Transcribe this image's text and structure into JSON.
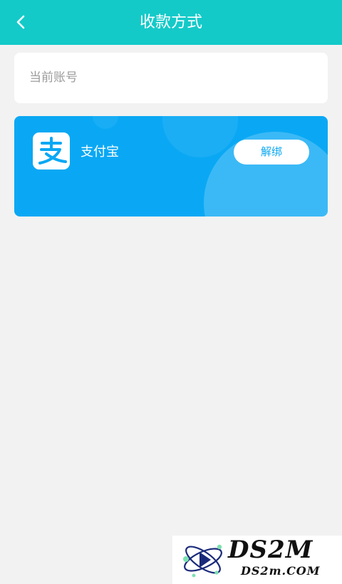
{
  "header": {
    "title": "收款方式",
    "back_icon": "chevron-left-icon",
    "background_color": "#13cac9"
  },
  "account": {
    "label": "当前账号"
  },
  "alipay": {
    "name": "支付宝",
    "logo_text": "支",
    "logo_icon": "alipay-logo-icon",
    "unbind_label": "解绑",
    "card_color": "#0aa8f4"
  },
  "watermark": {
    "brand": "DS2M",
    "domain": "DS2m.COM"
  }
}
